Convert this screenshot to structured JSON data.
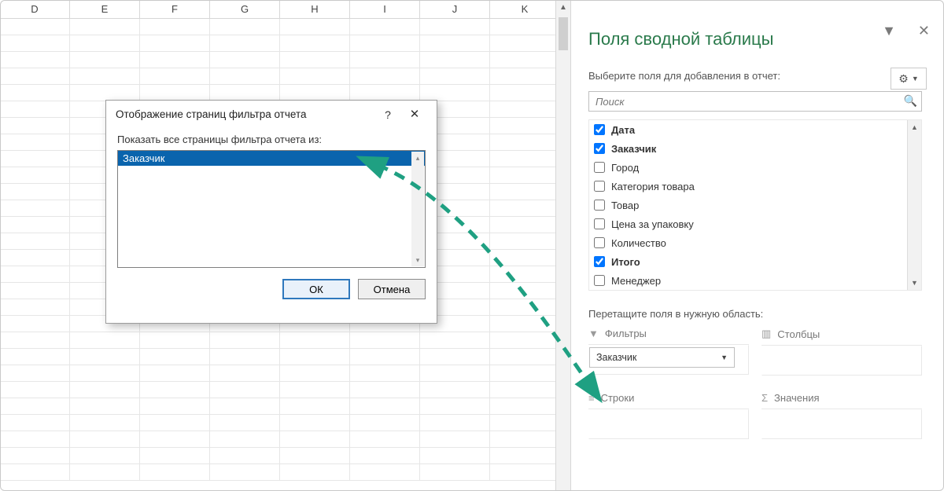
{
  "sheet": {
    "columns": [
      "D",
      "E",
      "F",
      "G",
      "H",
      "I",
      "J",
      "K"
    ]
  },
  "dialog": {
    "title": "Отображение страниц фильтра отчета",
    "help": "?",
    "close": "✕",
    "label": "Показать все страницы фильтра отчета из:",
    "selected_item": "Заказчик",
    "ok": "ОК",
    "cancel": "Отмена"
  },
  "pane": {
    "title": "Поля сводной таблицы",
    "collapse": "▼",
    "close": "✕",
    "subtitle": "Выберите поля для добавления в отчет:",
    "gear": "⚙",
    "gear_caret": "▼",
    "search_placeholder": "Поиск",
    "fields": [
      {
        "label": "Дата",
        "checked": true
      },
      {
        "label": "Заказчик",
        "checked": true
      },
      {
        "label": "Город",
        "checked": false
      },
      {
        "label": "Категория товара",
        "checked": false
      },
      {
        "label": "Товар",
        "checked": false
      },
      {
        "label": "Цена за упаковку",
        "checked": false
      },
      {
        "label": "Количество",
        "checked": false
      },
      {
        "label": "Итого",
        "checked": true
      },
      {
        "label": "Менеджер",
        "checked": false
      }
    ],
    "drag_label": "Перетащите поля в нужную область:",
    "areas": {
      "filters": {
        "label": "Фильтры",
        "chip": "Заказчик"
      },
      "columns": {
        "label": "Столбцы"
      },
      "rows": {
        "label": "Строки"
      },
      "values": {
        "label": "Значения"
      }
    }
  },
  "colors": {
    "accent_green": "#1fa082",
    "dlg_selected": "#0a64ad"
  }
}
